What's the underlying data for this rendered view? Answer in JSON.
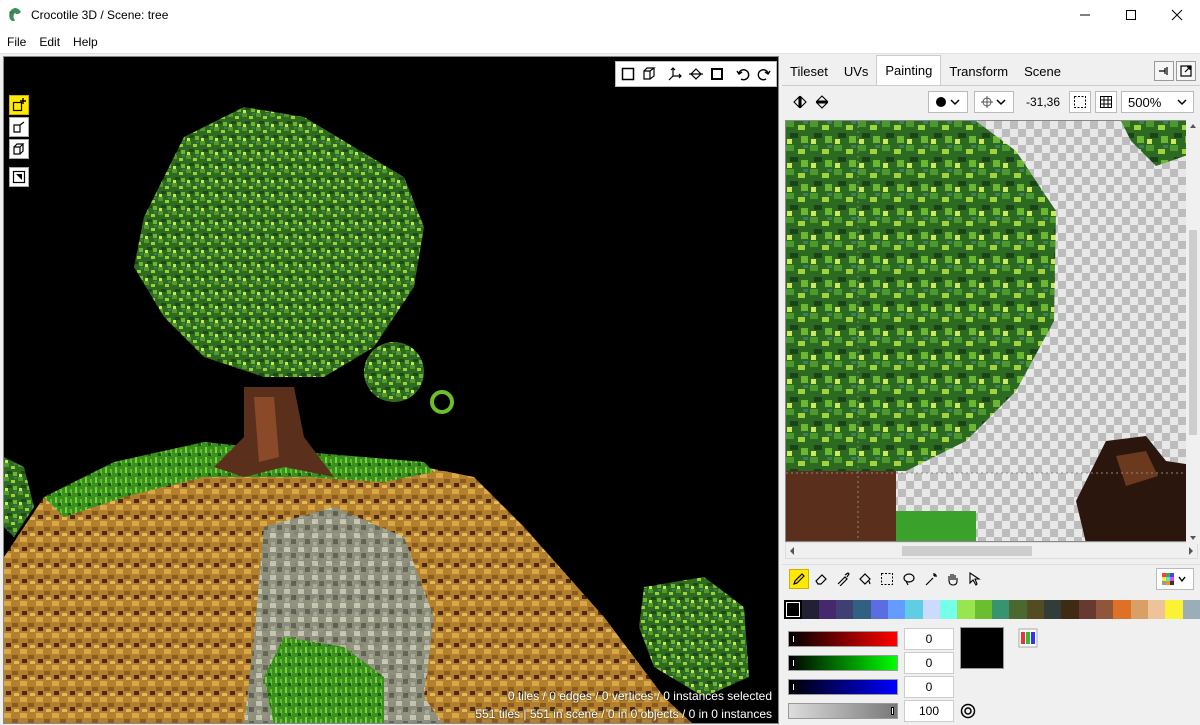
{
  "window": {
    "title": "Crocotile 3D / Scene: tree",
    "controls": [
      "minimize",
      "maximize",
      "close"
    ]
  },
  "menu": [
    "File",
    "Edit",
    "Help"
  ],
  "viewport": {
    "status_line1": "0 tiles / 0 edges / 0 vertices / 0 instances selected",
    "status_line2": "551 tiles | 551 in scene / 0 in 0 objects / 0 in 0 instances"
  },
  "panel": {
    "tabs": [
      "Tileset",
      "UVs",
      "Painting",
      "Transform",
      "Scene"
    ],
    "active_tab": "Painting",
    "cursor_coords": "-31,36",
    "zoom": "500%",
    "colors": {
      "red_value": "0",
      "green_value": "0",
      "blue_value": "0",
      "alpha_value": "100",
      "current_color": "#000000"
    },
    "palette": [
      "#000000",
      "#222034",
      "#45286e",
      "#3f3f74",
      "#306082",
      "#5b6ee1",
      "#639bff",
      "#5fcde4",
      "#cbdbfc",
      "#76ffe8",
      "#99e550",
      "#6abe30",
      "#37946e",
      "#4b692f",
      "#524b24",
      "#323c39",
      "#3f2a14",
      "#663931",
      "#8f563b",
      "#df7126",
      "#d9a066",
      "#eec39a",
      "#fbf236",
      "#9badb7"
    ]
  }
}
